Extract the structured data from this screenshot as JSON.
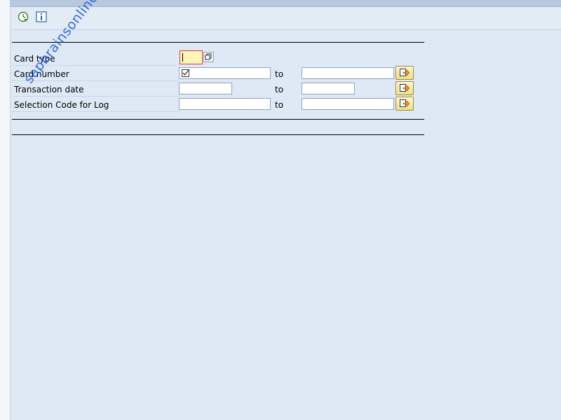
{
  "toolbar": {
    "execute_icon": "execute-clock-icon",
    "info_icon": "info-icon"
  },
  "selection": {
    "to_label": "to",
    "rows": [
      {
        "label": "Card type",
        "low_value": "",
        "high_value": null
      },
      {
        "label": "Card number",
        "low_value": "",
        "high_value": ""
      },
      {
        "label": "Transaction date",
        "low_value": "",
        "high_value": ""
      },
      {
        "label": "Selection Code for Log",
        "low_value": "",
        "high_value": ""
      }
    ]
  },
  "watermark": "sapbrainsonline.com",
  "colors": {
    "background": "#dfe9f5",
    "required_field": "#fff5b8",
    "multi_button": "#f1dd8a"
  }
}
